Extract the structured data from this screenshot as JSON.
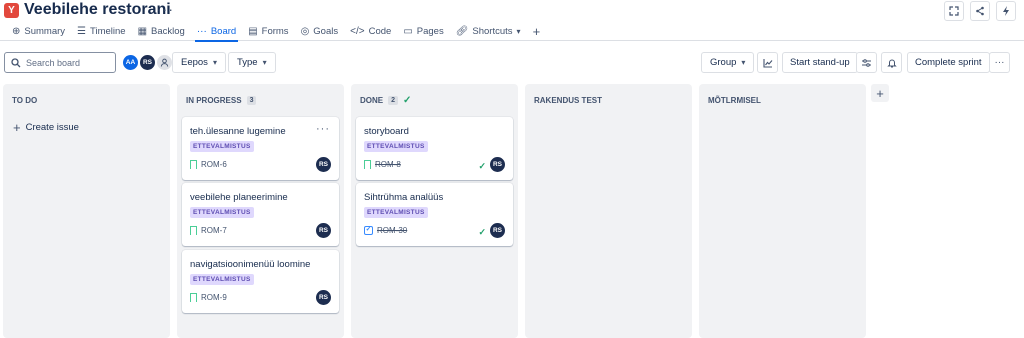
{
  "project": {
    "icon_letter": "Y",
    "title": "Veebilehe restorani",
    "more": "···"
  },
  "top_actions": {
    "expand": "⤢",
    "share": "⋖",
    "automation": "⚡"
  },
  "nav": {
    "tabs": [
      {
        "label": "Summary",
        "icon": "🌐"
      },
      {
        "label": "Timeline",
        "icon": "≡"
      },
      {
        "label": "Backlog",
        "icon": "☷"
      },
      {
        "label": "Board",
        "icon": "···"
      },
      {
        "label": "Forms",
        "icon": "☰"
      },
      {
        "label": "Goals",
        "icon": "◎"
      },
      {
        "label": "Code",
        "icon": "</>"
      },
      {
        "label": "Pages",
        "icon": "▤"
      },
      {
        "label": "Shortcuts",
        "icon": "⛓"
      }
    ],
    "shortcuts_chevron": "⌄",
    "add": "+"
  },
  "toolbar": {
    "search_placeholder": "Search board",
    "avatars": [
      "AA",
      "RS"
    ],
    "filter1": "Eepos",
    "filter2": "Type",
    "group": "Group",
    "start_standup": "Start stand-up",
    "complete_sprint": "Complete sprint",
    "more": "···"
  },
  "columns": [
    {
      "name": "TO DO",
      "count": "",
      "create_label": "Create issue"
    },
    {
      "name": "IN PROGRESS",
      "count": "3"
    },
    {
      "name": "DONE",
      "count": "2"
    },
    {
      "name": "RAKENDUS TEST",
      "count": ""
    },
    {
      "name": "MÕTLRMISEL",
      "count": ""
    }
  ],
  "cards": {
    "in_progress": [
      {
        "title": "teh.ülesanne lugemine",
        "label": "ETTEVALMISTUS",
        "key": "ROM-6",
        "assignee": "RS",
        "more": "···"
      },
      {
        "title": "veebilehe planeerimine",
        "label": "ETTEVALMISTUS",
        "key": "ROM-7",
        "assignee": "RS"
      },
      {
        "title": "navigatsioonimenüü loomine",
        "label": "ETTEVALMISTUS",
        "key": "ROM-9",
        "assignee": "RS"
      }
    ],
    "done": [
      {
        "title": "storyboard",
        "label": "ETTEVALMISTUS",
        "key": "ROM-8",
        "assignee": "RS",
        "check": "✓"
      },
      {
        "title": "Sihtrühma analüüs",
        "label": "ETTEVALMISTUS",
        "key": "ROM-30",
        "assignee": "RS",
        "check": "✓"
      }
    ]
  },
  "colors": {
    "accent": "#0c66e4",
    "lozenge_bg": "#dfd8fd",
    "lozenge_fg": "#5e4db2",
    "done_green": "#22a06b",
    "project_icon": "#e2483d"
  }
}
